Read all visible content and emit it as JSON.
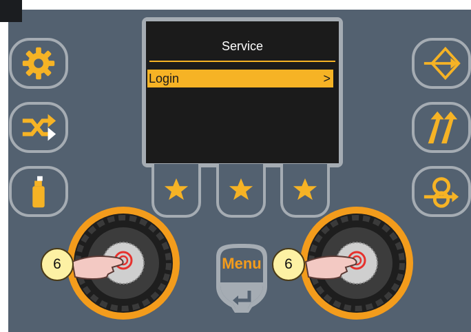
{
  "display": {
    "title": "Service",
    "items": [
      {
        "label": "Login",
        "arrow": ">"
      }
    ]
  },
  "menu_button": {
    "label": "Menu"
  },
  "callouts": [
    {
      "number": "6"
    },
    {
      "number": "6"
    }
  ],
  "icons": {
    "left": [
      "gear-icon",
      "shuffle-icon",
      "spray-can-icon"
    ],
    "right": [
      "diamond-arrow-icon",
      "slash-arrows-icon",
      "loop-arrow-icon"
    ],
    "softkeys": [
      "star-icon",
      "star-icon",
      "star-icon"
    ],
    "menu_return": "return-arrow-icon"
  },
  "colors": {
    "panel": "#536170",
    "accent": "#f6b325",
    "knob_ring": "#f39c1c",
    "frame": "#a5acb3",
    "display_bg": "#1b1b1b"
  }
}
